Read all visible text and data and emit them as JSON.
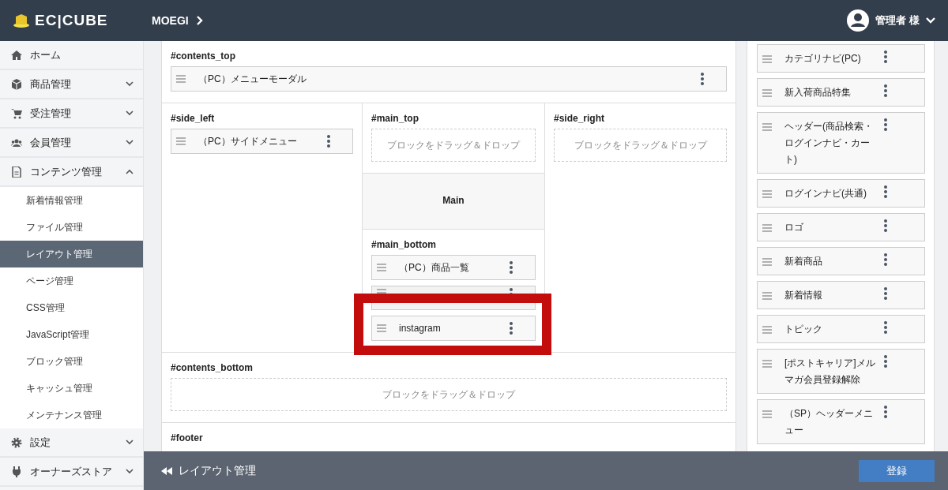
{
  "header": {
    "logo_text": "EC|CUBE",
    "shop_name": "MOEGI",
    "user": "管理者 様"
  },
  "sidebar": {
    "items": [
      {
        "label": "ホーム"
      },
      {
        "label": "商品管理",
        "expanded": false
      },
      {
        "label": "受注管理",
        "expanded": false
      },
      {
        "label": "会員管理",
        "expanded": false
      },
      {
        "label": "コンテンツ管理",
        "expanded": true,
        "children": [
          {
            "label": "新着情報管理",
            "selected": false
          },
          {
            "label": "ファイル管理",
            "selected": false
          },
          {
            "label": "レイアウト管理",
            "selected": true
          },
          {
            "label": "ページ管理",
            "selected": false
          },
          {
            "label": "CSS管理",
            "selected": false
          },
          {
            "label": "JavaScript管理",
            "selected": false
          },
          {
            "label": "ブロック管理",
            "selected": false
          },
          {
            "label": "キャッシュ管理",
            "selected": false
          },
          {
            "label": "メンテナンス管理",
            "selected": false
          }
        ]
      },
      {
        "label": "設定",
        "expanded": false
      },
      {
        "label": "オーナーズストア",
        "expanded": false
      }
    ]
  },
  "layout_rows": [
    {
      "columns": [
        {
          "sections": [
            {
              "title": "#contents_top",
              "blocks": [
                {
                  "label": "（PC）メニューモーダル"
                }
              ]
            }
          ]
        }
      ]
    },
    {
      "columns": [
        {
          "sections": [
            {
              "title": "#side_left",
              "blocks": [
                {
                  "label": "（PC）サイドメニュー"
                }
              ]
            }
          ]
        },
        {
          "sections": [
            {
              "title": "#main_top",
              "placeholder": "ブロックをドラッグ＆ドロップ"
            },
            {
              "kind": "main",
              "title": "Main"
            },
            {
              "title": "#main_bottom",
              "blocks": [
                {
                  "label": "（PC）商品一覧",
                  "covered": false
                },
                {
                  "covered": true
                },
                {
                  "label": "instagram",
                  "covered": false
                }
              ]
            }
          ]
        },
        {
          "sections": [
            {
              "title": "#side_right",
              "placeholder": "ブロックをドラッグ＆ドロップ"
            }
          ]
        }
      ]
    },
    {
      "columns": [
        {
          "sections": [
            {
              "title": "#contents_bottom",
              "placeholder": "ブロックをドラッグ＆ドロップ"
            }
          ]
        }
      ]
    },
    {
      "columns": [
        {
          "sections": [
            {
              "title": "#footer"
            }
          ]
        }
      ]
    }
  ],
  "unused_blocks": [
    {
      "label": "カテゴリナビ(PC)"
    },
    {
      "label": "新入荷商品特集"
    },
    {
      "label": "ヘッダー(商品検索・ログインナビ・カート)"
    },
    {
      "label": "ログインナビ(共通)"
    },
    {
      "label": "ロゴ"
    },
    {
      "label": "新着商品"
    },
    {
      "label": "新着情報"
    },
    {
      "label": "トピック"
    },
    {
      "label": "[ポストキャリア]メルマガ会員登録解除"
    },
    {
      "label": "（SP）ヘッダーメニュー"
    }
  ],
  "bottom_bar": {
    "back_label": "レイアウト管理",
    "button": "登録"
  }
}
